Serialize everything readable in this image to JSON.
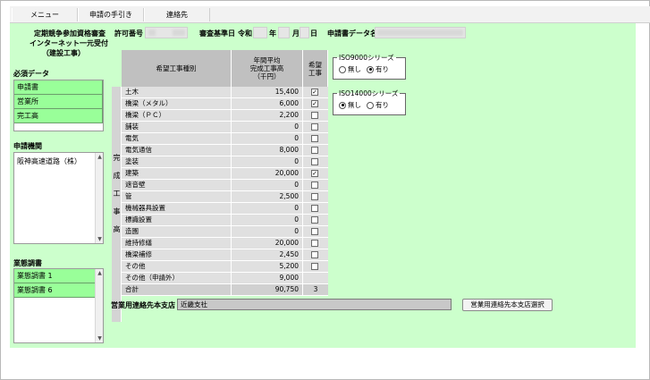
{
  "menu": {
    "tabs": [
      {
        "label": "メニュー"
      },
      {
        "label": "申請の手引き"
      },
      {
        "label": "連絡先"
      }
    ]
  },
  "header": {
    "title_line1": "定期競争参加資格審査",
    "title_line2": "インターネット一元受付",
    "title_line3": "（建設工事）",
    "permit_label": "許可番号",
    "review_date_label": "審査基準日",
    "era": "令和",
    "year_suffix": "年",
    "month_suffix": "月",
    "day_suffix": "日",
    "applicant_label": "申請書データ名"
  },
  "sidebar": {
    "required_label": "必須データ",
    "required_items": [
      {
        "label": "申請書"
      },
      {
        "label": "営業所"
      },
      {
        "label": "完工高"
      }
    ],
    "agency_label": "申請機関",
    "agency_items": [
      {
        "label": "阪神高速道路（株）"
      }
    ],
    "survey_label": "業態調書",
    "survey_items": [
      {
        "label": "業態調書 1"
      },
      {
        "label": "業態調書 6"
      }
    ]
  },
  "grid": {
    "header_type": "希望工事種別",
    "header_avg": "年間平均\n完成工事高\n（千円）",
    "header_hope": "希望\n工事",
    "side_chars": [
      "完",
      "成",
      "工",
      "事",
      "高"
    ],
    "rows": [
      {
        "name": "土木",
        "value": "15,400",
        "checked": true
      },
      {
        "name": "橋梁（メタル）",
        "value": "6,000",
        "checked": true
      },
      {
        "name": "橋梁（ＰＣ）",
        "value": "2,200",
        "checked": false
      },
      {
        "name": "舗装",
        "value": "0",
        "checked": false
      },
      {
        "name": "電気",
        "value": "0",
        "checked": false
      },
      {
        "name": "電気通信",
        "value": "8,000",
        "checked": false
      },
      {
        "name": "塗装",
        "value": "0",
        "checked": false
      },
      {
        "name": "建築",
        "value": "20,000",
        "checked": true
      },
      {
        "name": "遮音壁",
        "value": "0",
        "checked": false
      },
      {
        "name": "管",
        "value": "2,500",
        "checked": false
      },
      {
        "name": "機械器具設置",
        "value": "0",
        "checked": false
      },
      {
        "name": "標識設置",
        "value": "0",
        "checked": false
      },
      {
        "name": "造園",
        "value": "0",
        "checked": false
      },
      {
        "name": "維持修繕",
        "value": "20,000",
        "checked": false
      },
      {
        "name": "橋梁補修",
        "value": "2,450",
        "checked": false
      },
      {
        "name": "その他",
        "value": "5,200",
        "checked": false
      },
      {
        "name": "その他（申請外）",
        "value": "9,000",
        "checked": null
      }
    ],
    "total": {
      "name": "合計",
      "value": "90,750",
      "count": "3"
    },
    "check_mark": "✓"
  },
  "iso9000": {
    "legend": "ISO9000シリーズ",
    "options": [
      {
        "label": "無し",
        "selected": false
      },
      {
        "label": "有り",
        "selected": true
      }
    ]
  },
  "iso14000": {
    "legend": "ISO14000シリーズ",
    "options": [
      {
        "label": "無し",
        "selected": true
      },
      {
        "label": "有り",
        "selected": false
      }
    ]
  },
  "footer": {
    "branch_label": "営業用連絡先本支店",
    "branch_value": "近畿支社",
    "branch_button": "営業用連絡先本支店選択"
  }
}
